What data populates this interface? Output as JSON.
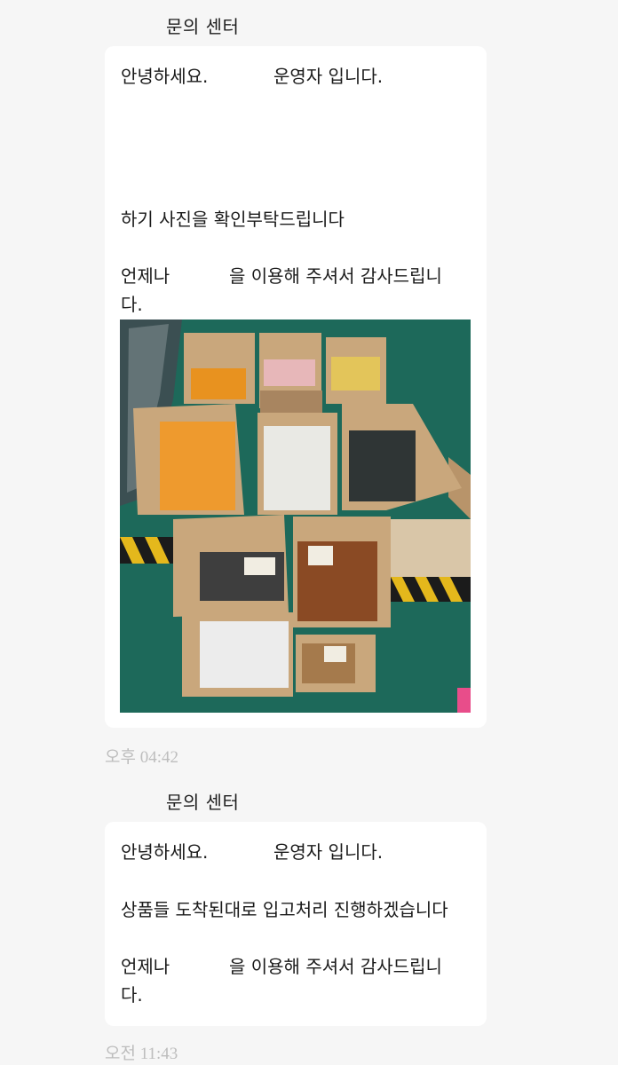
{
  "messages": [
    {
      "sender": "문의 센터",
      "greeting_left": "안녕하세요.",
      "greeting_right": "운영자 입니다.",
      "body": "하기 사진을 확인부탁드립니다",
      "closing_left": "언제나",
      "closing_right": "을 이용해 주셔서 감사드립니",
      "closing_tail": "다.",
      "photo_alt": "photo",
      "time": "오후 04:42"
    },
    {
      "sender": "문의 센터",
      "greeting_left": "안녕하세요.",
      "greeting_right": "운영자 입니다.",
      "body": "상품들 도착된대로 입고처리 진행하겠습니다",
      "closing_left": "언제나",
      "closing_right": "을 이용해 주셔서 감사드립니",
      "closing_tail": "다.",
      "time": "오전 11:43"
    }
  ],
  "colors": {
    "background": "#f6f6f6",
    "bubble": "#ffffff",
    "timestamp": "#bdbdbd",
    "floor": "#1f6f5f",
    "cardboard": "#c9a77c"
  }
}
